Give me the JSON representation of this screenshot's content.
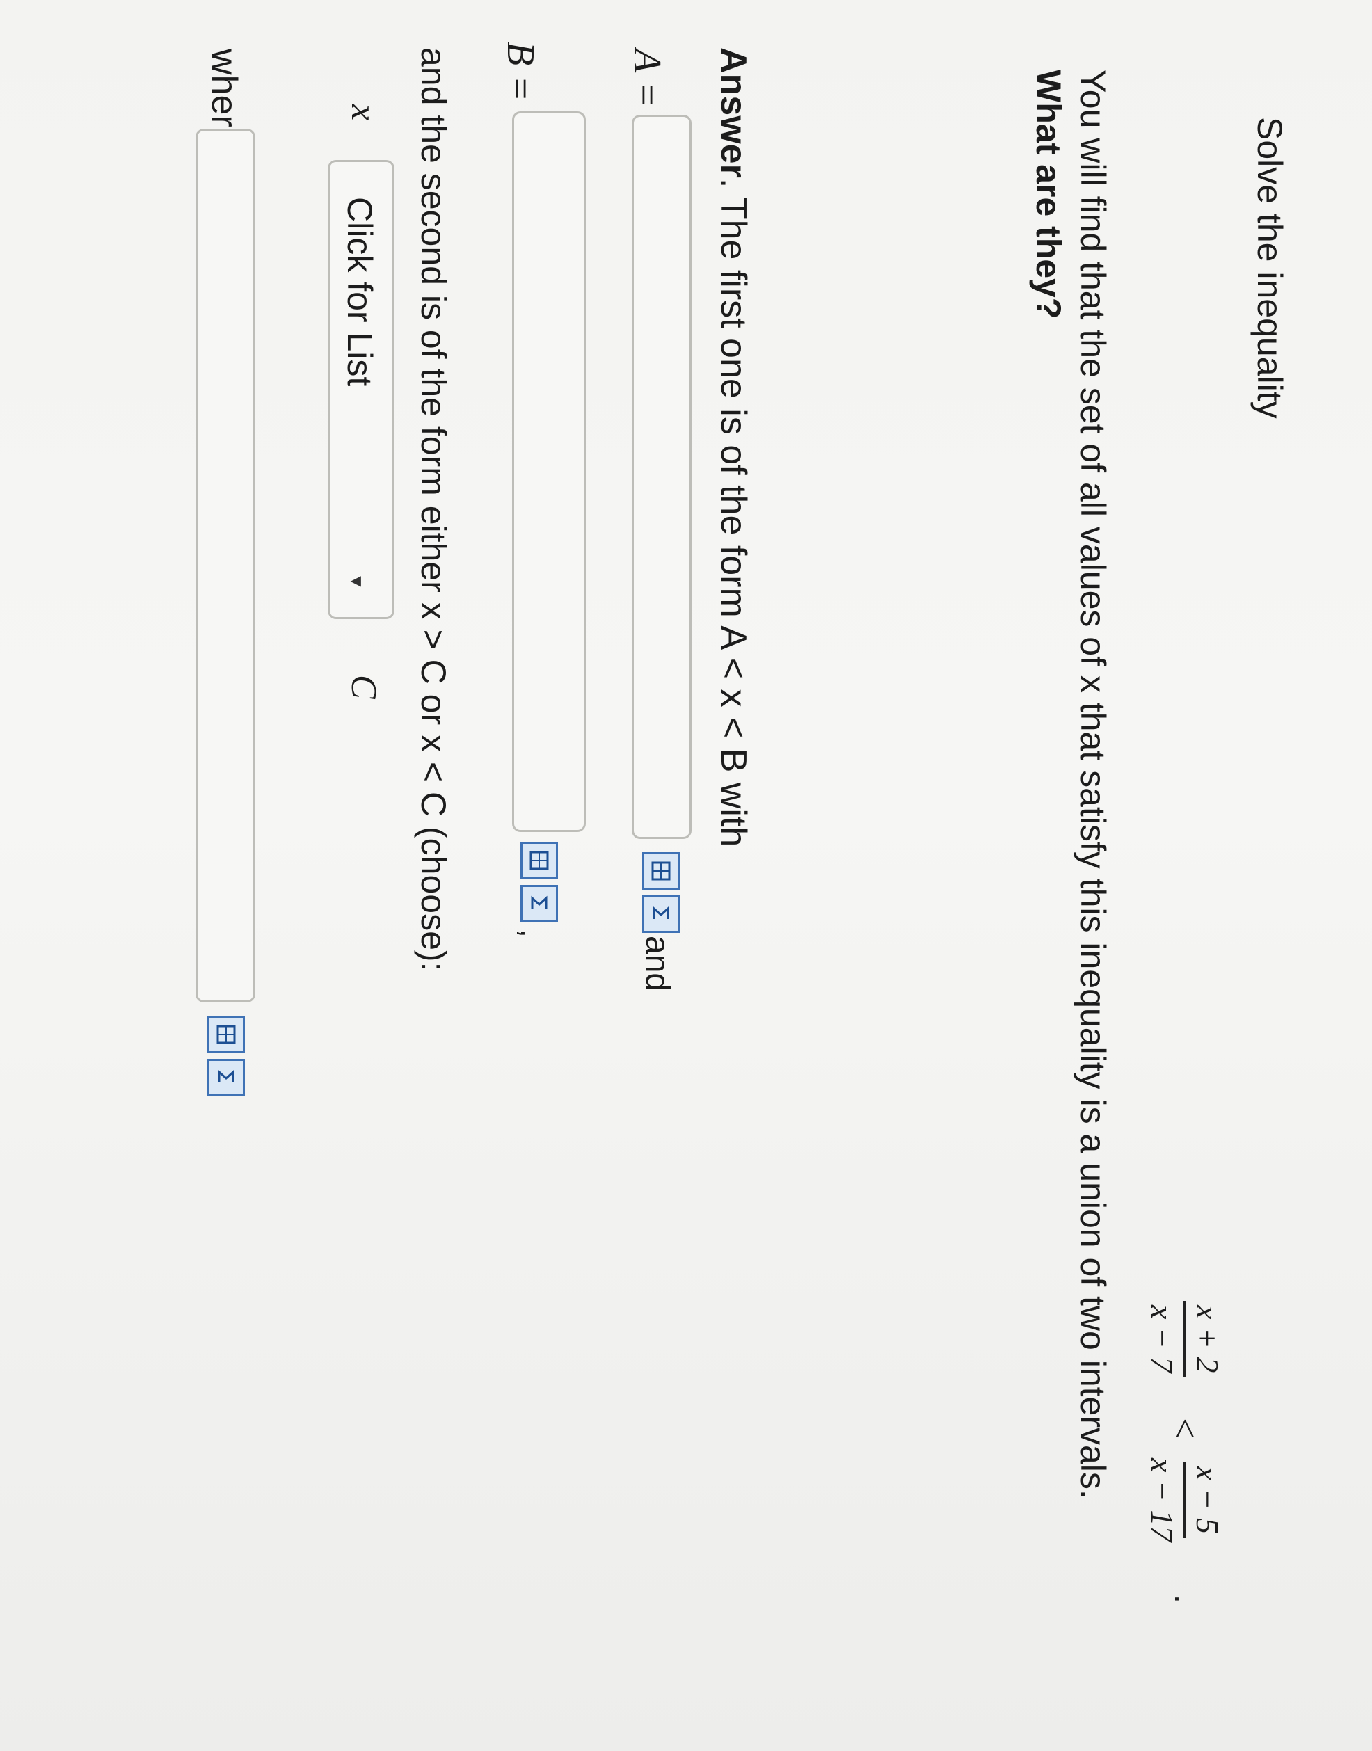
{
  "question": {
    "intro": "Solve the inequality",
    "fraction_left": {
      "numerator": "x + 2",
      "denominator": "x − 7"
    },
    "relation": "<",
    "fraction_right": {
      "numerator": "x − 5",
      "denominator": "x − 17"
    },
    "end_punct": ".",
    "paragraph1": "You will find that the set of all values of x that satisfy this inequality is a union of two intervals.",
    "paragraph2": "What are they?"
  },
  "answer": {
    "label": "Answer",
    "first_form": ". The first one is of the form A < x < B with",
    "A_label": "A =",
    "B_label": "B =",
    "A_value": "",
    "B_value": "",
    "and_text": "and",
    "comma_text": ",",
    "second_form": "and the second is of the form either x > C or x < C (choose):",
    "select_x": "x",
    "select_placeholder": "Click for List",
    "select_C": "C",
    "where_label": "where C =",
    "C_value": ""
  },
  "icons": [
    "matrix-template-icon",
    "sigma-symbol-icon"
  ],
  "colors": {
    "button_border": "#3f72b5",
    "button_fill": "#dbe8f6",
    "input_border": "#bdbdb8"
  }
}
